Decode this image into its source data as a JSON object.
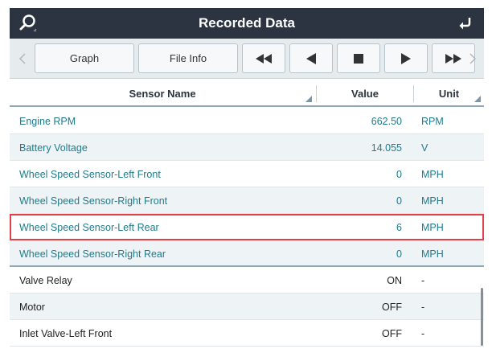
{
  "header": {
    "title": "Recorded Data"
  },
  "toolbar": {
    "graph_label": "Graph",
    "fileinfo_label": "File Info"
  },
  "table": {
    "columns": {
      "name": "Sensor Name",
      "value": "Value",
      "unit": "Unit"
    },
    "rows": [
      {
        "name": "Engine RPM",
        "value": "662.50",
        "unit": "RPM"
      },
      {
        "name": "Battery Voltage",
        "value": "14.055",
        "unit": "V"
      },
      {
        "name": "Wheel Speed Sensor-Left Front",
        "value": "0",
        "unit": "MPH"
      },
      {
        "name": "Wheel Speed Sensor-Right Front",
        "value": "0",
        "unit": "MPH"
      },
      {
        "name": "Wheel Speed Sensor-Left Rear",
        "value": "6",
        "unit": "MPH",
        "selected": true
      },
      {
        "name": "Wheel Speed Sensor-Right Rear",
        "value": "0",
        "unit": "MPH"
      },
      {
        "name": "Valve Relay",
        "value": "ON",
        "unit": "-"
      },
      {
        "name": "Motor",
        "value": "OFF",
        "unit": "-"
      },
      {
        "name": "Inlet Valve-Left Front",
        "value": "OFF",
        "unit": "-"
      }
    ]
  },
  "colors": {
    "titlebar": "#2b3440",
    "selected_outline": "#e0404a",
    "teal_text": "#1f7b8c"
  },
  "icons": {
    "search": "search-icon",
    "return": "return-icon",
    "rewind": "rewind-icon",
    "step_back": "step-back-icon",
    "stop": "stop-icon",
    "play": "play-icon",
    "fast_forward": "fast-forward-icon",
    "prev": "chevron-left-icon",
    "next": "chevron-right-icon"
  }
}
